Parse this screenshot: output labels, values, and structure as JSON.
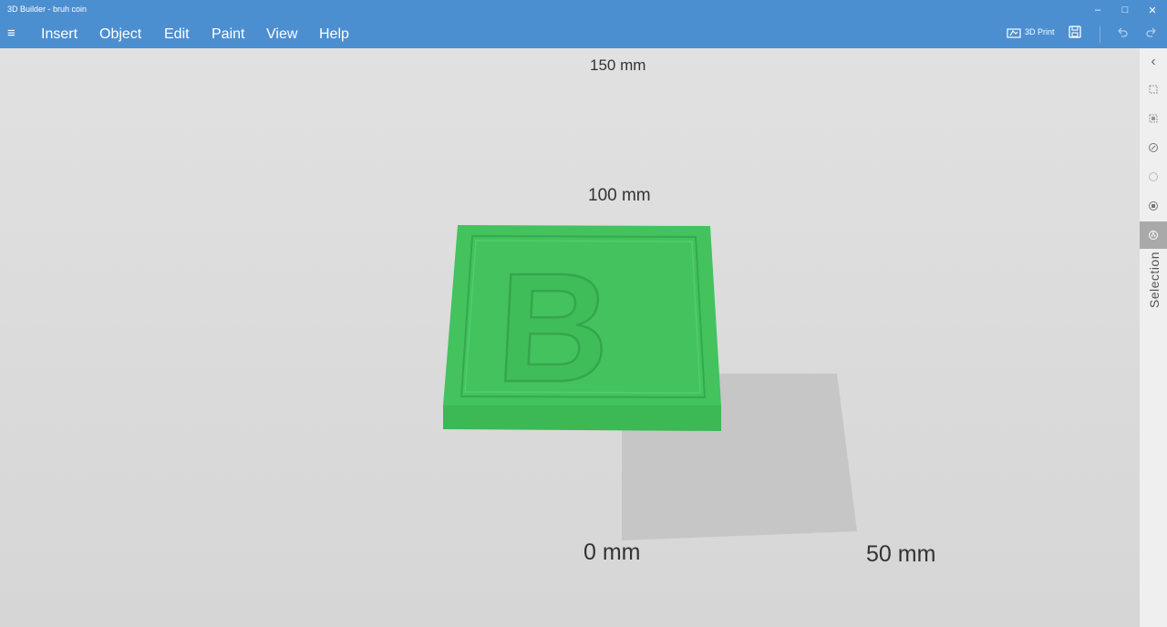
{
  "window": {
    "title": "3D Builder - bruh coin"
  },
  "window_controls": {
    "minimize": "–",
    "restore": "□",
    "close": "✕"
  },
  "menu": {
    "hamburger": "≡",
    "items": [
      "Insert",
      "Object",
      "Edit",
      "Paint",
      "View",
      "Help"
    ]
  },
  "toolbar": {
    "print_label": "3D Print"
  },
  "viewport": {
    "labels": {
      "y150": "150 mm",
      "y100": "100 mm",
      "x0": "0 mm",
      "x50": "50 mm"
    },
    "object": {
      "letter": "B",
      "color": "#3fc05c"
    }
  },
  "side_panel": {
    "label": "Selection",
    "collapse": "‹"
  }
}
